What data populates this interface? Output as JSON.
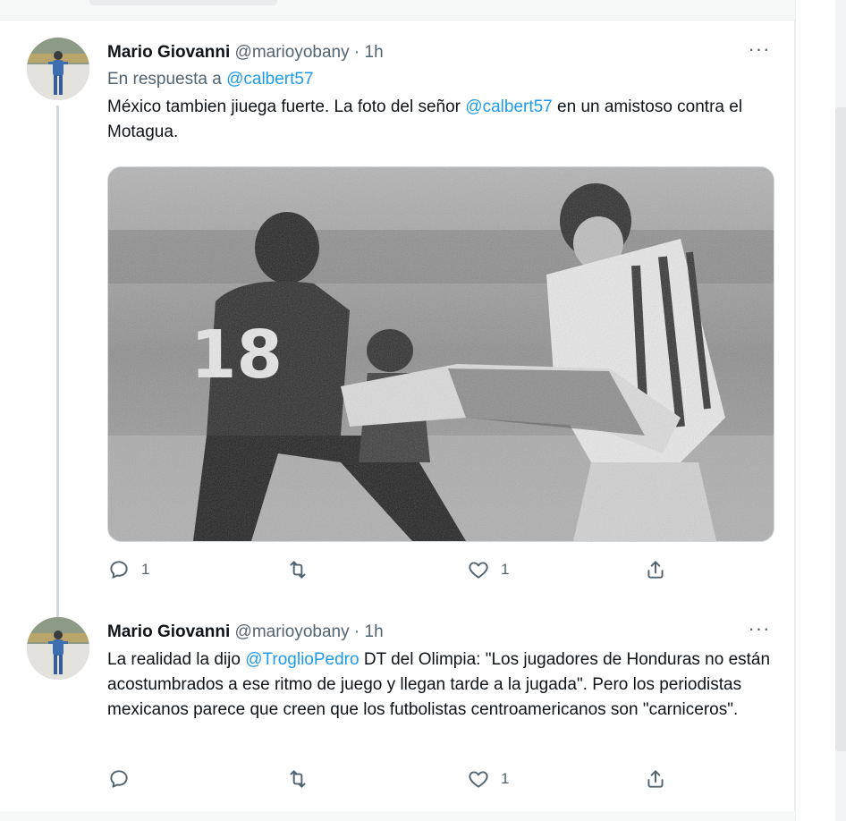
{
  "tweets": [
    {
      "author_name": "Mario Giovanni",
      "handle": "@marioyobany",
      "separator": "·",
      "time": "1h",
      "more_label": "···",
      "reply_prefix": "En respuesta a",
      "reply_mention": "@calbert57",
      "text_before": "México tambien jiuega fuerte. La foto del señor ",
      "text_mention": "@calbert57",
      "text_after": " en un amistoso contra el Motagua.",
      "media": {
        "jersey_number": "18"
      },
      "actions": {
        "reply_count": "1",
        "retweet_count": "",
        "like_count": "1"
      }
    },
    {
      "author_name": "Mario Giovanni",
      "handle": "@marioyobany",
      "separator": "·",
      "time": "1h",
      "more_label": "···",
      "text_before": "La realidad la dijo ",
      "text_mention": "@TroglioPedro",
      "text_after": " DT del Olimpia: \"Los jugadores de Honduras no están acostumbrados a ese ritmo de juego y llegan tarde a la jugada\". Pero los periodistas mexicanos parece que creen que los futbolistas centroamericanos son \"carniceros\".",
      "actions": {
        "reply_count": "",
        "retweet_count": "",
        "like_count": "1"
      }
    }
  ],
  "icons": {
    "reply": "reply-icon",
    "retweet": "retweet-icon",
    "like": "heart-icon",
    "share": "share-icon",
    "more": "more-icon"
  },
  "colors": {
    "link": "#1d9bf0",
    "secondary_text": "#536471",
    "primary_text": "#0f1419"
  }
}
